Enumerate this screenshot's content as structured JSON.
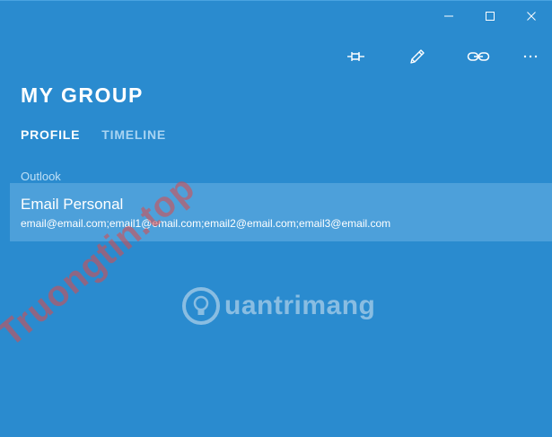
{
  "window_controls": {
    "minimize": "minimize-icon",
    "maximize": "maximize-icon",
    "close": "close-icon"
  },
  "toolbar": {
    "pin": "pin-icon",
    "edit": "pencil-icon",
    "link": "link-icon",
    "more": "more-icon"
  },
  "group": {
    "title": "MY GROUP"
  },
  "tabs": [
    {
      "label": "PROFILE",
      "active": true
    },
    {
      "label": "TIMELINE",
      "active": false
    }
  ],
  "section": {
    "label": "Outlook"
  },
  "contact": {
    "name": "Email Personal",
    "emails": "email@email.com;email1@email.com;email2@email.com;email3@email.com"
  },
  "watermarks": {
    "logo_text": "uantrimang",
    "diagonal_text": "Truongtin.top"
  },
  "colors": {
    "background": "#2a8bcf",
    "row_highlight": "#4da0da",
    "inactive_tab": "#a9d4f2",
    "watermark_red": "#e04848"
  }
}
